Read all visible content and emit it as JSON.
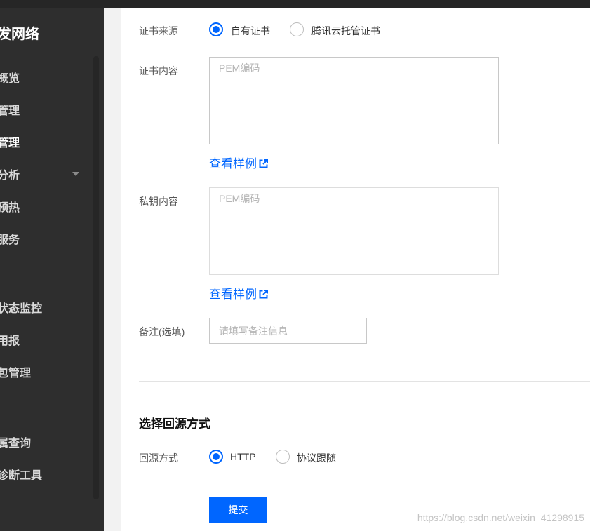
{
  "sidebar": {
    "title": "发网络",
    "items": [
      {
        "label": "概览"
      },
      {
        "label": "管理"
      },
      {
        "label": "管理"
      },
      {
        "label": "分析"
      },
      {
        "label": "预热"
      },
      {
        "label": "服务"
      },
      {
        "label": "状态监控"
      },
      {
        "label": "用报"
      },
      {
        "label": "包管理"
      },
      {
        "label": "属查询"
      },
      {
        "label": "诊断工具"
      }
    ],
    "caret_icon": "caret-down-icon"
  },
  "form": {
    "cert_source": {
      "label": "证书来源",
      "options": [
        {
          "label": "自有证书",
          "selected": true
        },
        {
          "label": "腾讯云托管证书",
          "selected": false
        }
      ]
    },
    "cert_content": {
      "label": "证书内容",
      "placeholder": "PEM编码",
      "value": "",
      "example_link": "查看样例"
    },
    "private_key": {
      "label": "私钥内容",
      "placeholder": "PEM编码",
      "value": "",
      "example_link": "查看样例"
    },
    "remark": {
      "label": "备注(选填)",
      "placeholder": "请填写备注信息",
      "value": ""
    },
    "origin_section": {
      "title": "选择回源方式",
      "label": "回源方式",
      "options": [
        {
          "label": "HTTP",
          "selected": true
        },
        {
          "label": "协议跟随",
          "selected": false
        }
      ]
    },
    "submit_label": "提交"
  },
  "watermark": "https://blog.csdn.net/weixin_41298915",
  "colors": {
    "accent": "#0066ff",
    "sidebar_bg": "#2e2e2e",
    "topbar_bg": "#262626",
    "content_bg": "#ffffff"
  },
  "icons": {
    "external_link": "external-link-icon"
  }
}
